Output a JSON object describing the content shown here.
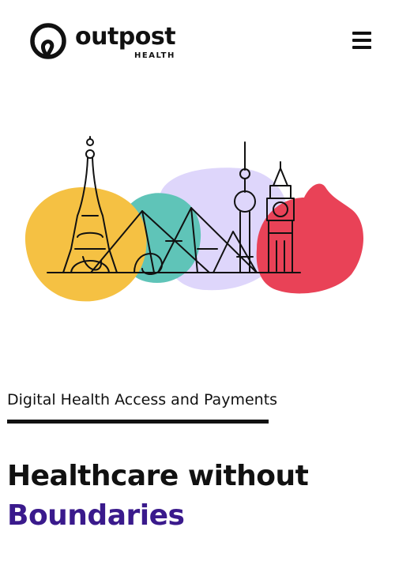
{
  "header": {
    "logo_word": "outpost",
    "logo_sub": "HEALTH",
    "menu_icon": "hamburger-menu-icon"
  },
  "hero": {
    "illustration": "world-landmarks-illustration",
    "colors": {
      "yellow": "#f5c143",
      "teal": "#5fc4b8",
      "lavender": "#ded6fb",
      "red": "#e94257"
    }
  },
  "main": {
    "tagline": "Digital Health Access and Payments",
    "headline_line1": "Healthcare without",
    "headline_line2": "Boundaries",
    "accent_color": "#3a1a8c"
  }
}
